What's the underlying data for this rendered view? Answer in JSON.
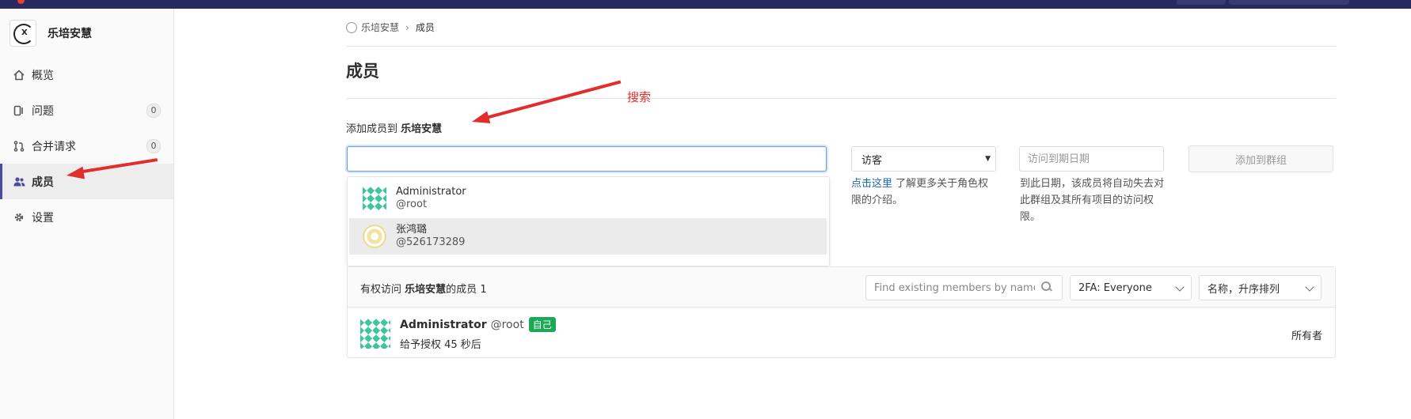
{
  "sidebar": {
    "group_name": "乐培安慧",
    "items": [
      {
        "label": "概览",
        "icon": "home-icon",
        "badge": ""
      },
      {
        "label": "问题",
        "icon": "issues-icon",
        "badge": "0"
      },
      {
        "label": "合并请求",
        "icon": "merge-request-icon",
        "badge": "0"
      },
      {
        "label": "成员",
        "icon": "users-icon",
        "badge": ""
      },
      {
        "label": "设置",
        "icon": "gear-icon",
        "badge": ""
      }
    ],
    "active_index": 3
  },
  "breadcrumb": {
    "group": "乐培安慧",
    "current": "成员"
  },
  "page": {
    "title": "成员"
  },
  "add_member": {
    "label_prefix": "添加成员到",
    "group_name": "乐培安慧",
    "search_value": "",
    "role_value": "访客",
    "role_help_link": "点击这里",
    "role_help_text": "了解更多关于角色权限的介绍。",
    "expires_placeholder": "访问到期日期",
    "expires_help": "到此日期，该成员将自动失去对此群组及其所有项目的访问权限。",
    "submit_label": "添加到群组"
  },
  "suggestions": [
    {
      "name": "Administrator",
      "username": "@root",
      "avatar": "identicon-green"
    },
    {
      "name": "张鸿璐",
      "username": "@526173289",
      "avatar": "identicon-yellow"
    }
  ],
  "members_panel": {
    "title_prefix": "有权访问",
    "group_name": "乐培安慧",
    "title_suffix": "的成员",
    "count": "1",
    "filter_placeholder": "Find existing members by name",
    "twofa_filter": "2FA: Everyone",
    "sort": "名称，升序排列"
  },
  "members": [
    {
      "name": "Administrator",
      "username": "@root",
      "badge": "自己",
      "granted": "给予授权 45 秒后",
      "role": "所有者"
    }
  ],
  "annotation": {
    "text": "搜索",
    "color": "#e22d2d"
  },
  "colors": {
    "topbar": "#292961",
    "accent": "#4b4ba3",
    "link": "#1b69b6",
    "success": "#1aaa55"
  }
}
